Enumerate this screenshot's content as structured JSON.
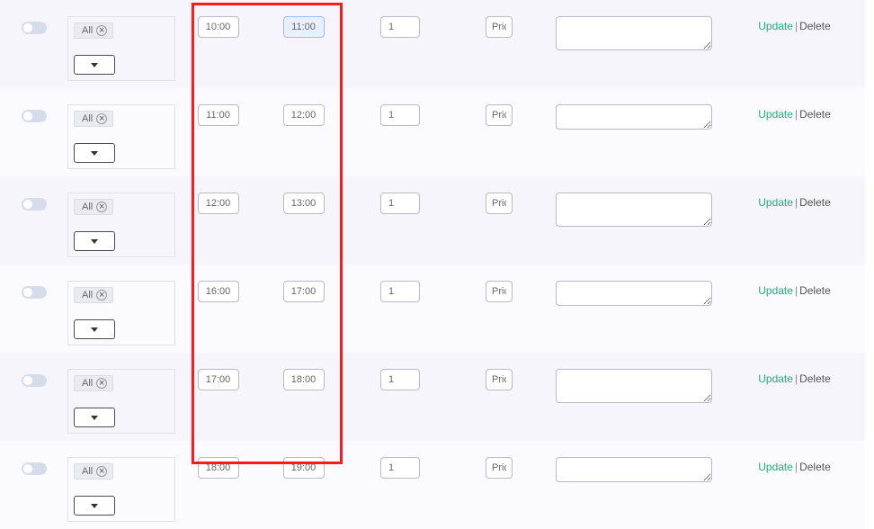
{
  "labels": {
    "chipText": "All",
    "update": "Update",
    "delete": "Delete"
  },
  "rows": [
    {
      "shade": "a",
      "start": "10:00",
      "end": "11:00",
      "endHighlighted": true,
      "qty": "1",
      "pric": "Pric",
      "desc": "",
      "tall": true
    },
    {
      "shade": "b",
      "start": "11:00",
      "end": "12:00",
      "endHighlighted": false,
      "qty": "1",
      "pric": "Pric",
      "desc": "",
      "tall": false
    },
    {
      "shade": "a",
      "start": "12:00",
      "end": "13:00",
      "endHighlighted": false,
      "qty": "1",
      "pric": "Pric",
      "desc": "",
      "tall": true
    },
    {
      "shade": "b",
      "start": "16:00",
      "end": "17:00",
      "endHighlighted": false,
      "qty": "1",
      "pric": "Pric",
      "desc": "",
      "tall": false
    },
    {
      "shade": "a",
      "start": "17:00",
      "end": "18:00",
      "endHighlighted": false,
      "qty": "1",
      "pric": "Pric",
      "desc": "",
      "tall": true
    },
    {
      "shade": "b",
      "start": "18:00",
      "end": "19:00",
      "endHighlighted": false,
      "qty": "1",
      "pric": "Pric",
      "desc": "",
      "tall": false
    }
  ]
}
